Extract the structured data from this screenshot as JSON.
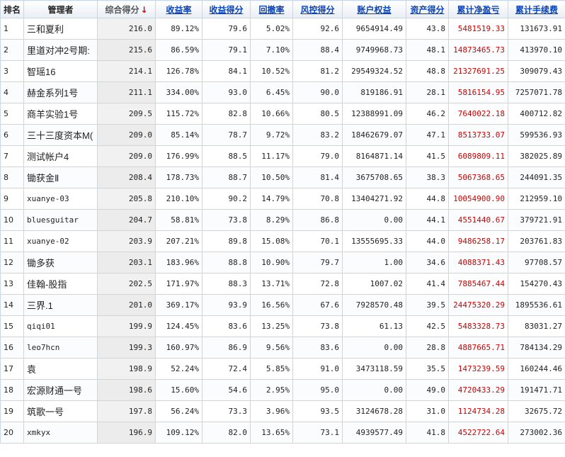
{
  "headers": {
    "rank": "排名",
    "manager": "管理者",
    "composite_score": "综合得分",
    "sort_arrow": "↓",
    "return_rate": "收益率",
    "return_score": "收益得分",
    "drawdown": "回撤率",
    "risk_score": "风控得分",
    "equity": "账户权益",
    "asset_score": "资产得分",
    "cum_pnl": "累计净盈亏",
    "cum_fee": "累计手续费"
  },
  "rows": [
    {
      "rank": "1",
      "name": "三和夏利",
      "score": "216.0",
      "ret": "89.12%",
      "ret_score": "79.6",
      "dd": "5.02%",
      "risk": "92.6",
      "equity": "9654914.49",
      "asset": "43.8",
      "pnl": "5481519.33",
      "fee": "131673.91"
    },
    {
      "rank": "2",
      "name": "里道对冲2号期:",
      "score": "215.6",
      "ret": "86.59%",
      "ret_score": "79.1",
      "dd": "7.10%",
      "risk": "88.4",
      "equity": "9749968.73",
      "asset": "48.1",
      "pnl": "14873465.73",
      "fee": "413970.10"
    },
    {
      "rank": "3",
      "name": "智瑶16",
      "score": "214.1",
      "ret": "126.78%",
      "ret_score": "84.1",
      "dd": "10.52%",
      "risk": "81.2",
      "equity": "29549324.52",
      "asset": "48.8",
      "pnl": "21327691.25",
      "fee": "309079.43"
    },
    {
      "rank": "4",
      "name": "赫金系列1号",
      "score": "211.1",
      "ret": "334.00%",
      "ret_score": "93.0",
      "dd": "6.45%",
      "risk": "90.0",
      "equity": "819186.91",
      "asset": "28.1",
      "pnl": "5816154.95",
      "fee": "7257071.78"
    },
    {
      "rank": "5",
      "name": "商羊实验1号",
      "score": "209.5",
      "ret": "115.72%",
      "ret_score": "82.8",
      "dd": "10.66%",
      "risk": "80.5",
      "equity": "12388991.09",
      "asset": "46.2",
      "pnl": "7640022.18",
      "fee": "400712.82"
    },
    {
      "rank": "6",
      "name": "三十三度资本M(",
      "score": "209.0",
      "ret": "85.14%",
      "ret_score": "78.7",
      "dd": "9.72%",
      "risk": "83.2",
      "equity": "18462679.07",
      "asset": "47.1",
      "pnl": "8513733.07",
      "fee": "599536.93"
    },
    {
      "rank": "7",
      "name": "测试帐户4",
      "score": "209.0",
      "ret": "176.99%",
      "ret_score": "88.5",
      "dd": "11.17%",
      "risk": "79.0",
      "equity": "8164871.14",
      "asset": "41.5",
      "pnl": "6089809.11",
      "fee": "382025.89"
    },
    {
      "rank": "8",
      "name": "锄获金Ⅱ",
      "score": "208.4",
      "ret": "178.73%",
      "ret_score": "88.7",
      "dd": "10.50%",
      "risk": "81.4",
      "equity": "3675708.65",
      "asset": "38.3",
      "pnl": "5067368.65",
      "fee": "244091.35"
    },
    {
      "rank": "9",
      "name": "xuanye-03",
      "score": "205.8",
      "ret": "210.10%",
      "ret_score": "90.2",
      "dd": "14.79%",
      "risk": "70.8",
      "equity": "13404271.92",
      "asset": "44.8",
      "pnl": "10054900.90",
      "fee": "212959.10"
    },
    {
      "rank": "10",
      "name": "bluesguitar",
      "score": "204.7",
      "ret": "58.81%",
      "ret_score": "73.8",
      "dd": "8.29%",
      "risk": "86.8",
      "equity": "0.00",
      "asset": "44.1",
      "pnl": "4551440.67",
      "fee": "379721.91"
    },
    {
      "rank": "11",
      "name": "xuanye-02",
      "score": "203.9",
      "ret": "207.21%",
      "ret_score": "89.8",
      "dd": "15.08%",
      "risk": "70.1",
      "equity": "13555695.33",
      "asset": "44.0",
      "pnl": "9486258.17",
      "fee": "203761.83"
    },
    {
      "rank": "12",
      "name": "锄多获",
      "score": "203.1",
      "ret": "183.96%",
      "ret_score": "88.8",
      "dd": "10.90%",
      "risk": "79.7",
      "equity": "1.00",
      "asset": "34.6",
      "pnl": "4088371.43",
      "fee": "97708.57"
    },
    {
      "rank": "13",
      "name": "佳翰-股指",
      "score": "202.5",
      "ret": "171.97%",
      "ret_score": "88.3",
      "dd": "13.71%",
      "risk": "72.8",
      "equity": "1007.02",
      "asset": "41.4",
      "pnl": "7885467.44",
      "fee": "154270.43"
    },
    {
      "rank": "14",
      "name": "三界.1",
      "score": "201.0",
      "ret": "369.17%",
      "ret_score": "93.9",
      "dd": "16.56%",
      "risk": "67.6",
      "equity": "7928570.48",
      "asset": "39.5",
      "pnl": "24475320.29",
      "fee": "1895536.61"
    },
    {
      "rank": "15",
      "name": "qiqi01",
      "score": "199.9",
      "ret": "124.45%",
      "ret_score": "83.6",
      "dd": "13.25%",
      "risk": "73.8",
      "equity": "61.13",
      "asset": "42.5",
      "pnl": "5483328.73",
      "fee": "83031.27"
    },
    {
      "rank": "16",
      "name": "leo7hcn",
      "score": "199.3",
      "ret": "160.97%",
      "ret_score": "86.9",
      "dd": "9.56%",
      "risk": "83.6",
      "equity": "0.00",
      "asset": "28.8",
      "pnl": "4887665.71",
      "fee": "784134.29"
    },
    {
      "rank": "17",
      "name": "袁",
      "score": "198.9",
      "ret": "52.24%",
      "ret_score": "72.4",
      "dd": "5.85%",
      "risk": "91.0",
      "equity": "3473118.59",
      "asset": "35.5",
      "pnl": "1473239.59",
      "fee": "160244.46"
    },
    {
      "rank": "18",
      "name": "宏源财通一号",
      "score": "198.6",
      "ret": "15.60%",
      "ret_score": "54.6",
      "dd": "2.95%",
      "risk": "95.0",
      "equity": "0.00",
      "asset": "49.0",
      "pnl": "4720433.29",
      "fee": "191471.71"
    },
    {
      "rank": "19",
      "name": "筑歌一号",
      "score": "197.8",
      "ret": "56.24%",
      "ret_score": "73.3",
      "dd": "3.96%",
      "risk": "93.5",
      "equity": "3124678.28",
      "asset": "31.0",
      "pnl": "1124734.28",
      "fee": "32675.72"
    },
    {
      "rank": "20",
      "name": "xmkyx",
      "score": "196.9",
      "ret": "109.12%",
      "ret_score": "82.0",
      "dd": "13.65%",
      "risk": "73.1",
      "equity": "4939577.49",
      "asset": "41.8",
      "pnl": "4522722.64",
      "fee": "273002.36"
    }
  ],
  "colors": {
    "header_link": "#0b43b8",
    "pnl": "#d00000",
    "sort_arrow": "#e00000",
    "border": "#c9d6e6"
  }
}
